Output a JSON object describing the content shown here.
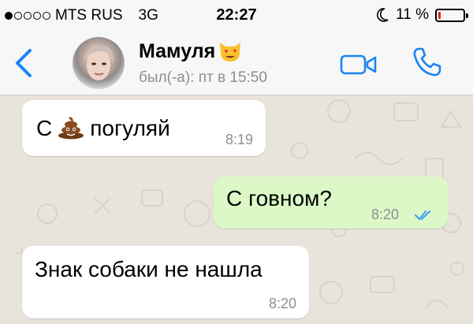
{
  "status_bar": {
    "carrier": "MTS RUS",
    "network": "3G",
    "time": "22:27",
    "battery_percent": "11 %",
    "battery_level": 0.11,
    "signal_bars": 1
  },
  "header": {
    "contact_name": "Мамуля",
    "name_emoji": "heart-eyes-cat-emoji",
    "last_seen": "был(-а): пт в 15:50"
  },
  "messages": [
    {
      "direction": "incoming",
      "text_before": "С",
      "emoji": "pile-of-poo",
      "text_after": "погуляй",
      "time": "8:19"
    },
    {
      "direction": "outgoing",
      "text": "С говном?",
      "time": "8:20",
      "read_ticks": "double-blue"
    },
    {
      "direction": "incoming",
      "text": "Знак собаки не нашла",
      "time": "8:20"
    }
  ],
  "colors": {
    "accent": "#1a84f5",
    "outgoing_bubble": "#dcf8c6",
    "incoming_bubble": "#ffffff",
    "battery_low": "#e02020"
  }
}
